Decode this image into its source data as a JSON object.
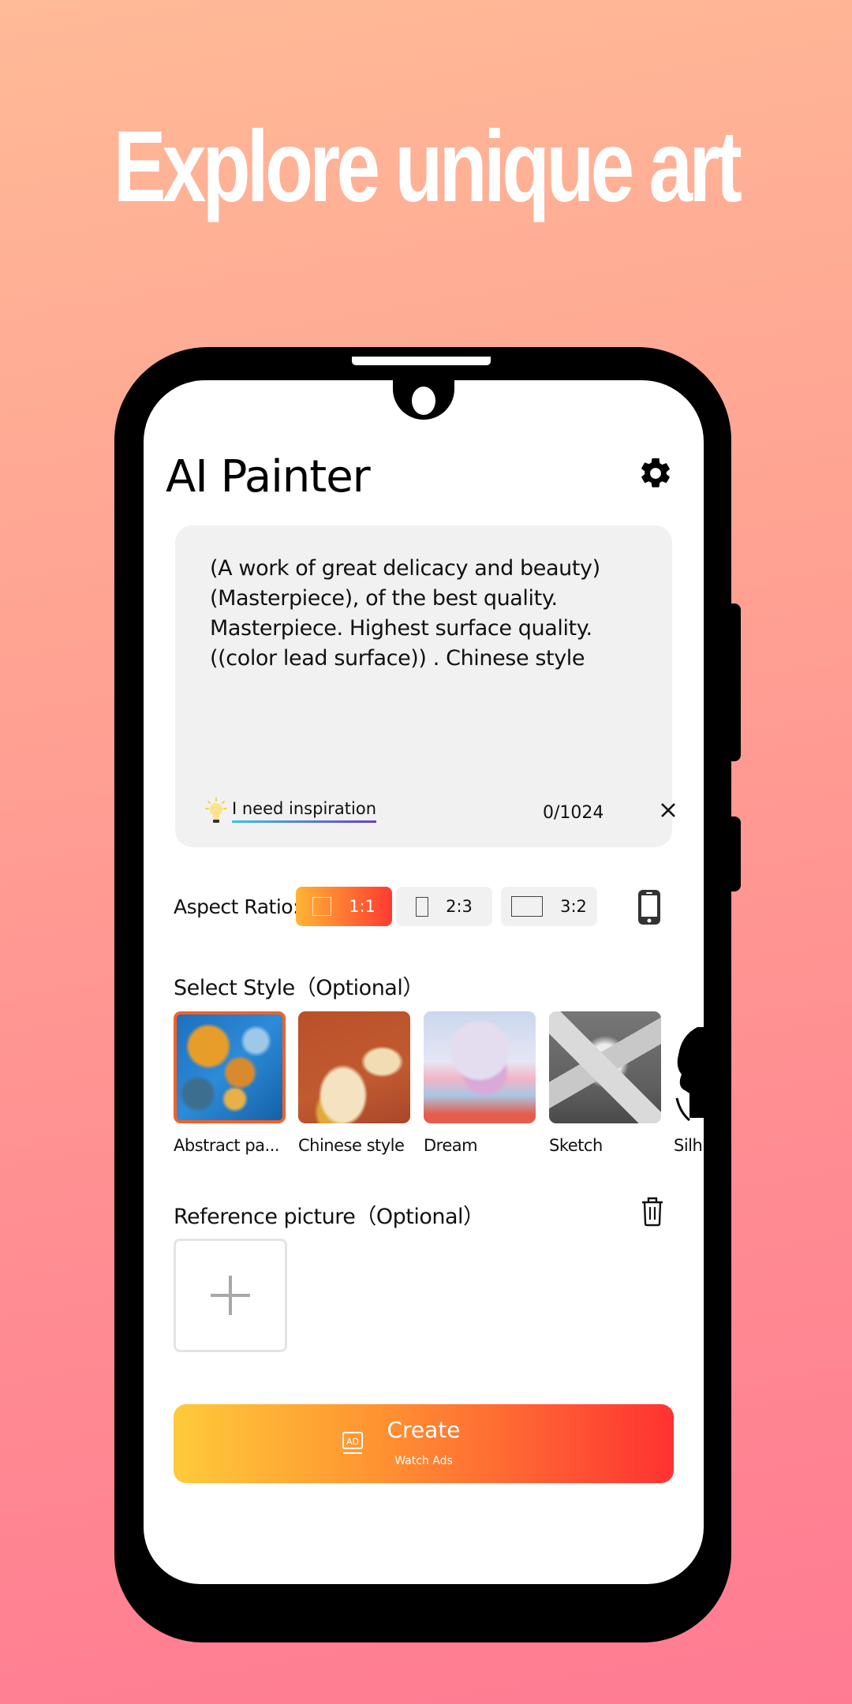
{
  "promo": {
    "headline": "Explore unique art"
  },
  "app": {
    "title": "AI Painter",
    "settings_icon": "gear-icon"
  },
  "prompt": {
    "text": "(A work of great delicacy and beauty)\n(Masterpiece), of the best quality.\nMasterpiece. Highest surface quality.\n((color lead surface)) .  Chinese style",
    "inspiration_label": "I need inspiration",
    "inspiration_icon": "lightbulb-icon",
    "char_count": "0/1024",
    "clear_icon": "close-icon"
  },
  "aspect": {
    "label": "Aspect Ratio:",
    "options": [
      {
        "label": "1:1",
        "selected": true
      },
      {
        "label": "2:3",
        "selected": false
      },
      {
        "label": "3:2",
        "selected": false
      }
    ],
    "device_icon": "smartphone-icon"
  },
  "styles": {
    "title": "Select Style（Optional）",
    "items": [
      {
        "name": "Abstract pa...",
        "selected": true
      },
      {
        "name": "Chinese style",
        "selected": false
      },
      {
        "name": "Dream",
        "selected": false
      },
      {
        "name": "Sketch",
        "selected": false
      },
      {
        "name": "Silh",
        "selected": false
      }
    ]
  },
  "reference": {
    "title": "Reference picture（Optional）",
    "delete_icon": "trash-icon",
    "add_icon": "plus-icon"
  },
  "create": {
    "label": "Create",
    "sublabel": "Watch Ads",
    "ad_icon": "ad-icon"
  },
  "colors": {
    "accent_start": "#FFCB3A",
    "accent_end": "#FF3232",
    "selected_border": "#F2612A"
  }
}
